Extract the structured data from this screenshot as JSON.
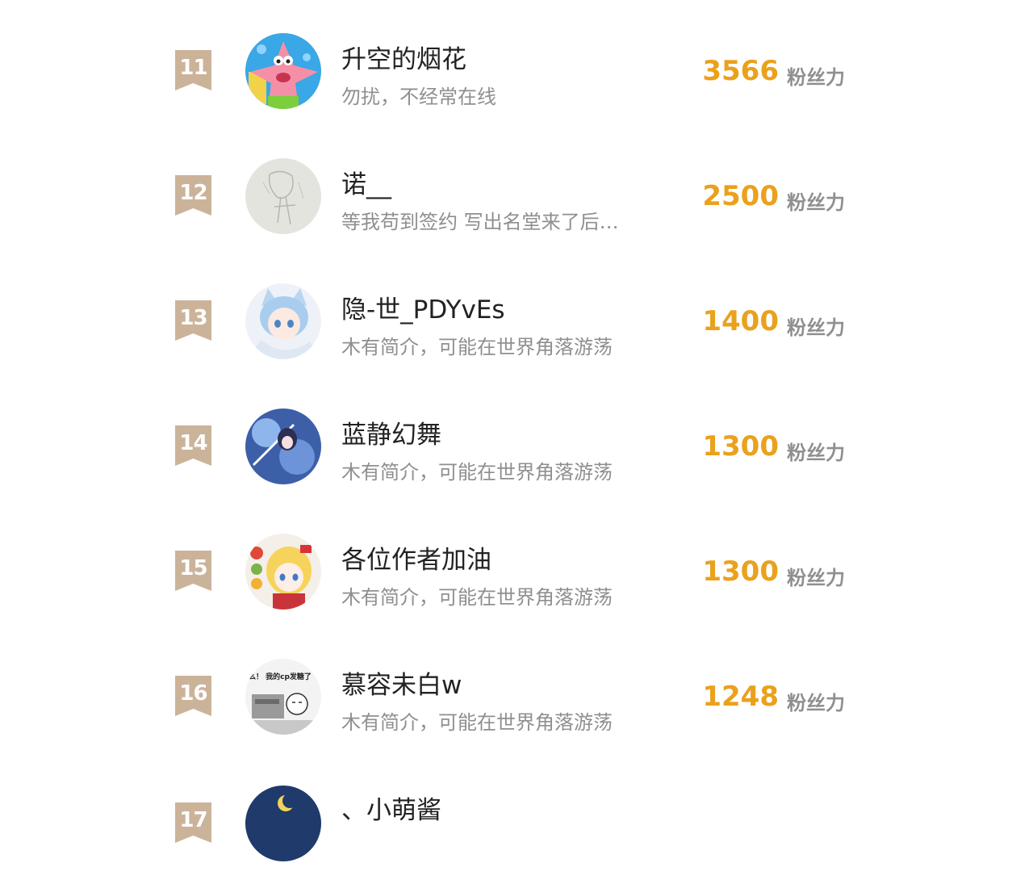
{
  "colors": {
    "badge": "#cbb39a",
    "score": "#eaa11c",
    "name": "#222222",
    "bio": "#8f8f8f"
  },
  "unit_label": "粉丝力",
  "entries": [
    {
      "rank": "11",
      "name": "升空的烟花",
      "bio": "勿扰，不经常在线",
      "score": "3566",
      "avatar": "patrick-star-avatar"
    },
    {
      "rank": "12",
      "name": "诺__",
      "bio": "等我苟到签约 写出名堂来了后…",
      "score": "2500",
      "avatar": "sketch-avatar"
    },
    {
      "rank": "13",
      "name": "隐-世_PDYvEs",
      "bio": "木有简介，可能在世界角落游荡",
      "score": "1400",
      "avatar": "anime-catgirl-avatar"
    },
    {
      "rank": "14",
      "name": "蓝静幻舞",
      "bio": "木有简介，可能在世界角落游荡",
      "score": "1300",
      "avatar": "blue-anime-avatar"
    },
    {
      "rank": "15",
      "name": "各位作者加油",
      "bio": "木有简介，可能在世界角落游荡",
      "score": "1300",
      "avatar": "blonde-anime-avatar"
    },
    {
      "rank": "16",
      "name": "慕容未白w",
      "bio": "木有简介，可能在世界角落游荡",
      "score": "1248",
      "avatar": "manga-meme-avatar",
      "avatar_text": "么！ 我的cp发糖了"
    },
    {
      "rank": "17",
      "name": "、小萌酱",
      "bio": "",
      "score": "",
      "avatar": "night-moon-avatar"
    }
  ]
}
